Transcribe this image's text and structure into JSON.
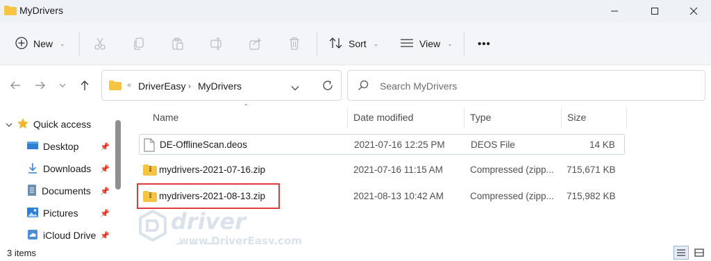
{
  "window": {
    "title": "MyDrivers"
  },
  "toolbar": {
    "new_label": "New",
    "sort_label": "Sort",
    "view_label": "View",
    "more_label": "•••"
  },
  "navigation": {
    "breadcrumb": [
      "DriverEasy",
      "MyDrivers"
    ],
    "overflow_marker": "«",
    "search_placeholder": "Search MyDrivers"
  },
  "sidebar": {
    "quick_access_label": "Quick access",
    "items": [
      {
        "label": "Desktop",
        "icon": "desktop-icon"
      },
      {
        "label": "Downloads",
        "icon": "download-icon"
      },
      {
        "label": "Documents",
        "icon": "documents-icon"
      },
      {
        "label": "Pictures",
        "icon": "pictures-icon"
      },
      {
        "label": "iCloud Drive",
        "icon": "icloud-icon"
      }
    ]
  },
  "columns": {
    "name": "Name",
    "date": "Date modified",
    "type": "Type",
    "size": "Size"
  },
  "files": [
    {
      "name": "DE-OfflineScan.deos",
      "date": "2021-07-16 12:25 PM",
      "type": "DEOS File",
      "size": "14 KB",
      "icon": "file-icon"
    },
    {
      "name": "mydrivers-2021-07-16.zip",
      "date": "2021-07-16 11:15 AM",
      "type": "Compressed (zipp...",
      "size": "715,671 KB",
      "icon": "zip-folder-icon"
    },
    {
      "name": "mydrivers-2021-08-13.zip",
      "date": "2021-08-13 10:42 AM",
      "type": "Compressed (zipp...",
      "size": "715,982 KB",
      "icon": "zip-folder-icon"
    }
  ],
  "status": {
    "item_count": "3 items"
  },
  "watermark": {
    "brand": "driver easy",
    "url": "www.DriverEasy.com"
  },
  "colors": {
    "folder": "#f4c442",
    "highlight_border": "#e0393e",
    "accent": "#0067c0"
  }
}
